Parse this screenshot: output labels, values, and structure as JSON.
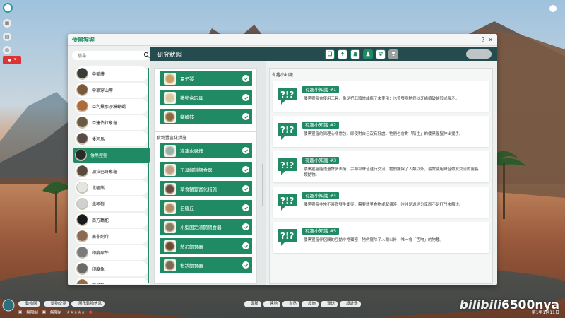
{
  "window": {
    "title": "倭黑猩猩",
    "help_label": "?",
    "close_label": "✕"
  },
  "search": {
    "placeholder": "搜尋"
  },
  "species": [
    {
      "name": "中美貘",
      "color": "#3a3a3a",
      "selected": false
    },
    {
      "name": "中華穿山甲",
      "color": "#7a5a3a",
      "selected": false
    },
    {
      "name": "亞利桑那沙漠蜥蜴",
      "color": "#b06a3a",
      "selected": false
    },
    {
      "name": "亞達伯拉象龜",
      "color": "#6a5a40",
      "selected": false
    },
    {
      "name": "倭河馬",
      "color": "#5a4a48",
      "selected": false
    },
    {
      "name": "倭黑猩猩",
      "color": "#2a2a2a",
      "selected": true
    },
    {
      "name": "加拉巴哥象龜",
      "color": "#5a4a3a",
      "selected": false
    },
    {
      "name": "北極熊",
      "color": "#e5e5e0",
      "selected": false
    },
    {
      "name": "北極狼",
      "color": "#d0d0d0",
      "selected": false
    },
    {
      "name": "南方鶴鴕",
      "color": "#1a1a1a",
      "selected": false
    },
    {
      "name": "南非劍羚",
      "color": "#8a6a50",
      "selected": false
    },
    {
      "name": "印度犀牛",
      "color": "#7a7a78",
      "selected": false
    },
    {
      "name": "印度象",
      "color": "#6a6a68",
      "selected": false
    },
    {
      "name": "文鳥羚",
      "color": "#9a6a40",
      "selected": false
    }
  ],
  "research": {
    "title": "研究狀態",
    "tabs": [
      {
        "icon": "book-icon",
        "active": false,
        "disabled": false
      },
      {
        "icon": "tree-icon",
        "active": false,
        "disabled": false
      },
      {
        "icon": "food-sack-icon",
        "active": false,
        "disabled": false
      },
      {
        "icon": "flask-icon",
        "active": true,
        "disabled": false
      },
      {
        "icon": "paw-icon",
        "active": false,
        "disabled": false
      },
      {
        "icon": "trophy-icon",
        "active": false,
        "disabled": true
      }
    ],
    "group1_items": [
      {
        "name": "電子琴",
        "thumb": "#c8a060"
      },
      {
        "name": "禮物盒玩具",
        "thumb": "#d8c8a0"
      },
      {
        "name": "蟻輪鼓",
        "thumb": "#8a6a3a"
      }
    ],
    "group2_label": "食物豐富化措施",
    "group2_items": [
      {
        "name": "冷凍水果塊",
        "thumb": "#9ab0a8"
      },
      {
        "name": "工具解謎餵食器",
        "thumb": "#c0a080"
      },
      {
        "name": "草食豬豐富化措施",
        "thumb": "#6a4a3a"
      },
      {
        "name": "白蟻丘",
        "thumb": "#b08a60"
      },
      {
        "name": "小型固定漂開餵食器",
        "thumb": "#8a7a60"
      },
      {
        "name": "懸吊餵食器",
        "thumb": "#6a4a30"
      },
      {
        "name": "樹狀餵食器",
        "thumb": "#7a6a50"
      }
    ]
  },
  "fun_facts": {
    "header": "有趣小知識",
    "items": [
      {
        "title": "有趣小知識 #1",
        "text": "倭黑猩猩會使用工具，像是把石頭當成瓶子來使用；也曾發現牠們以牙齒擠破蚌殼或長矛。"
      },
      {
        "title": "有趣小知識 #2",
        "text": "倭黑猩猩的同理心非常強，即使對自己沒有好處，牠們也會對「陌生」的倭黑猩猩伸出援手。"
      },
      {
        "title": "有趣小知識 #3",
        "text": "倭黑猩猩能透過許多表情、手勢和聲音進行交流，牠們擺除了人類以外，最常使用聲音徵此交流的靈長類動物。"
      },
      {
        "title": "有趣小知識 #4",
        "text": "倭黑猩猩非常不喜歡發生衝突，需要競爭食物或配偶時，往往是透過分享而不是打鬥來解決。"
      },
      {
        "title": "有趣小知識 #5",
        "text": "倭黑猩猩伴侶間的互動非常頻密，牠們擺除了人類以外，唯一會「舌吻」的物種。"
      }
    ]
  },
  "bottom": {
    "pills": [
      "動物園",
      "動物交易",
      "展示動物信息"
    ],
    "budget_label": "無限制",
    "budget_label2": "無限制",
    "stars": "★★★★★",
    "center_tabs": [
      "面積",
      "建地",
      "自然",
      "設施",
      "運送",
      "設計器"
    ],
    "date": "第1年1月11日",
    "watermark_bili": "bilibili",
    "watermark_num": "6500nya"
  },
  "hud": {
    "guest_count": "3"
  },
  "colors": {
    "accent": "#1f8a63",
    "header_dark": "#244b4d"
  }
}
